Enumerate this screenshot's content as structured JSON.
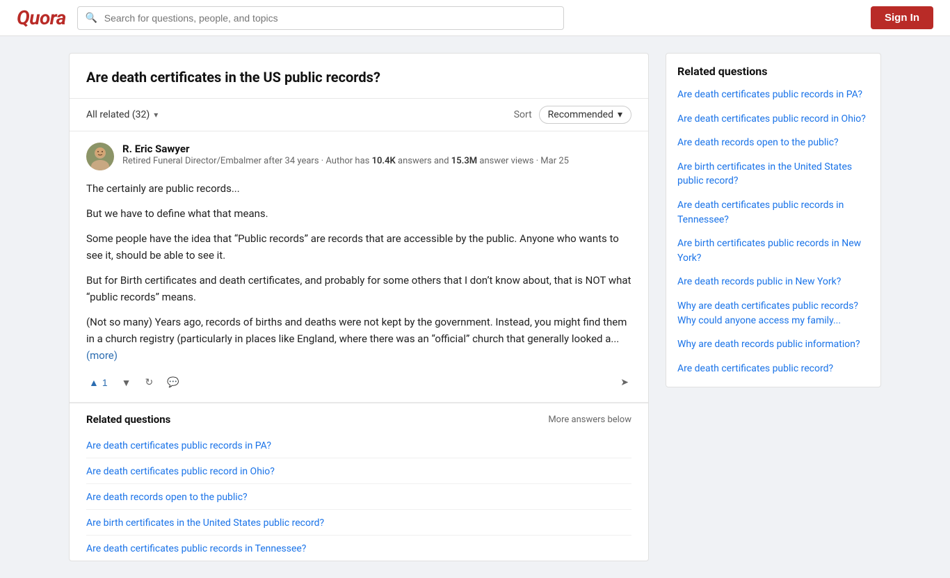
{
  "header": {
    "logo": "Quora",
    "search_placeholder": "Search for questions, people, and topics",
    "sign_in_label": "Sign In"
  },
  "question": {
    "title": "Are death certificates in the US public records?",
    "filter": {
      "label": "All related (32)",
      "sort_label": "Sort",
      "sort_value": "Recommended"
    }
  },
  "answer": {
    "author_name": "R. Eric Sawyer",
    "author_bio_prefix": "Retired Funeral Director/Embalmer after 34 years · Author has ",
    "author_answers": "10.4K",
    "author_bio_mid": " answers and ",
    "author_views": "15.3M",
    "author_bio_suffix": " answer views · Mar 25",
    "paragraphs": [
      "The certainly are public records...",
      "But we have to define what that means.",
      "Some people have the idea that “Public records” are records that are accessible by the public. Anyone who wants to see it, should be able to see it.",
      "But for Birth certificates and death certificates, and probably for some others that I don’t know about, that is NOT what “public records” means.",
      "(Not so many) Years ago, records of births and deaths were not kept by the government. Instead, you might find them in a church registry (particularly in places like England, where there was an “official” church that generally looked a..."
    ],
    "more_link": "(more)",
    "upvote_count": "1",
    "actions": {
      "upvote": "upvote",
      "downvote": "downvote",
      "share": "share",
      "comment": "comment",
      "reshare": "reshare"
    }
  },
  "related_inline": {
    "title": "Related questions",
    "more_answers_label": "More answers below",
    "items": [
      "Are death certificates public records in PA?",
      "Are death certificates public record in Ohio?",
      "Are death records open to the public?",
      "Are birth certificates in the United States public record?",
      "Are death certificates public records in Tennessee?"
    ]
  },
  "sidebar": {
    "title": "Related questions",
    "items": [
      "Are death certificates public records in PA?",
      "Are death certificates public record in Ohio?",
      "Are death records open to the public?",
      "Are birth certificates in the United States public record?",
      "Are death certificates public records in Tennessee?",
      "Are birth certificates public records in New York?",
      "Are death records public in New York?",
      "Why are death certificates public records? Why could anyone access my family...",
      "Why are death records public information?",
      "Are death certificates public record?"
    ]
  }
}
